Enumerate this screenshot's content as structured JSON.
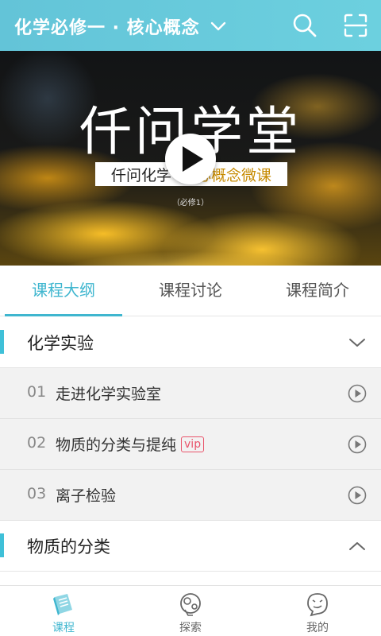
{
  "header": {
    "title": "化学必修一 · 核心概念",
    "dropdown_icon": "chevron-down-icon",
    "search_icon": "search-icon",
    "scan_icon": "scan-icon"
  },
  "banner": {
    "title": "仟问学堂",
    "subtitle_prefix": "仟问化学 · ",
    "subtitle_suffix": "核心概念微课",
    "note": "（必修1）",
    "play_icon": "play-icon"
  },
  "tabs": [
    {
      "label": "课程大纲",
      "active": true
    },
    {
      "label": "课程讨论",
      "active": false
    },
    {
      "label": "课程简介",
      "active": false
    }
  ],
  "sections": [
    {
      "title": "化学实验",
      "expanded": true,
      "lessons": [
        {
          "num": "01",
          "name": "走进化学实验室",
          "vip": ""
        },
        {
          "num": "02",
          "name": "物质的分类与提纯",
          "vip": "vip"
        },
        {
          "num": "03",
          "name": "离子检验",
          "vip": ""
        }
      ]
    },
    {
      "title": "物质的分类",
      "expanded": false
    }
  ],
  "nav": [
    {
      "label": "课程",
      "icon": "book-icon",
      "active": true
    },
    {
      "label": "探索",
      "icon": "explore-icon",
      "active": false
    },
    {
      "label": "我的",
      "icon": "profile-face-icon",
      "active": false
    }
  ],
  "colors": {
    "accent": "#3fb6cf",
    "header": "#63c4d8",
    "vip": "#e9546b"
  }
}
